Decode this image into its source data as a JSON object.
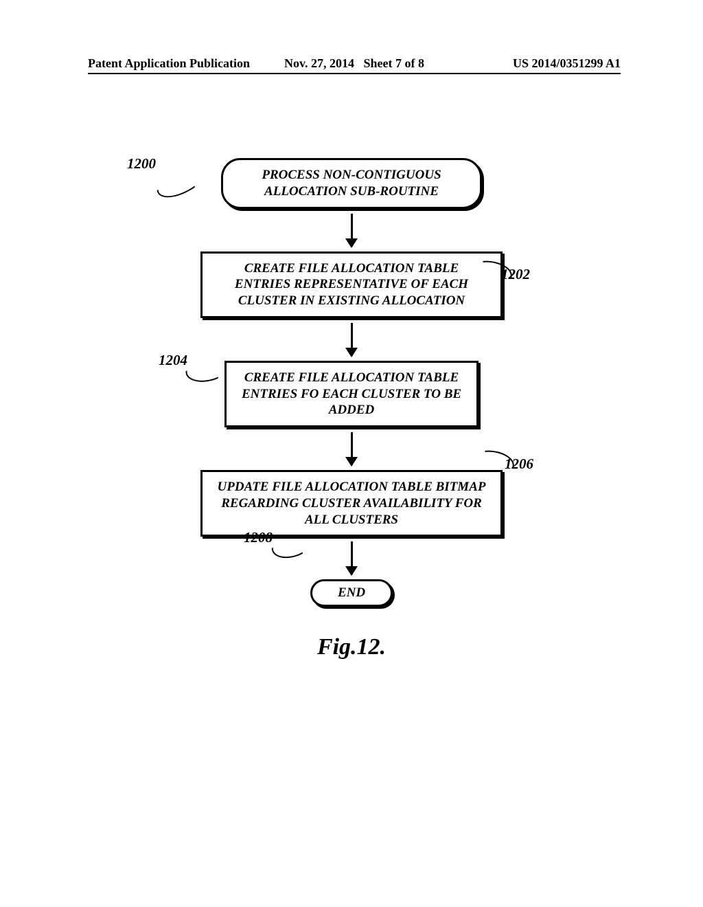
{
  "header": {
    "left": "Patent Application Publication",
    "date": "Nov. 27, 2014",
    "sheet": "Sheet 7 of 8",
    "right": "US 2014/0351299 A1"
  },
  "flowchart": {
    "start": "PROCESS NON-CONTIGUOUS ALLOCATION SUB-ROUTINE",
    "step1": "CREATE FILE ALLOCATION TABLE ENTRIES REPRESENTATIVE OF EACH CLUSTER IN EXISTING ALLOCATION",
    "step2": "CREATE FILE ALLOCATION TABLE ENTRIES FO EACH CLUSTER TO BE ADDED",
    "step3": "UPDATE FILE ALLOCATION TABLE BITMAP REGARDING CLUSTER AVAILABILITY FOR ALL CLUSTERS",
    "end": "END"
  },
  "labels": {
    "l1200": "1200",
    "l1202": "1202",
    "l1204": "1204",
    "l1206": "1206",
    "l1208": "1208"
  },
  "caption": "Fig.12."
}
